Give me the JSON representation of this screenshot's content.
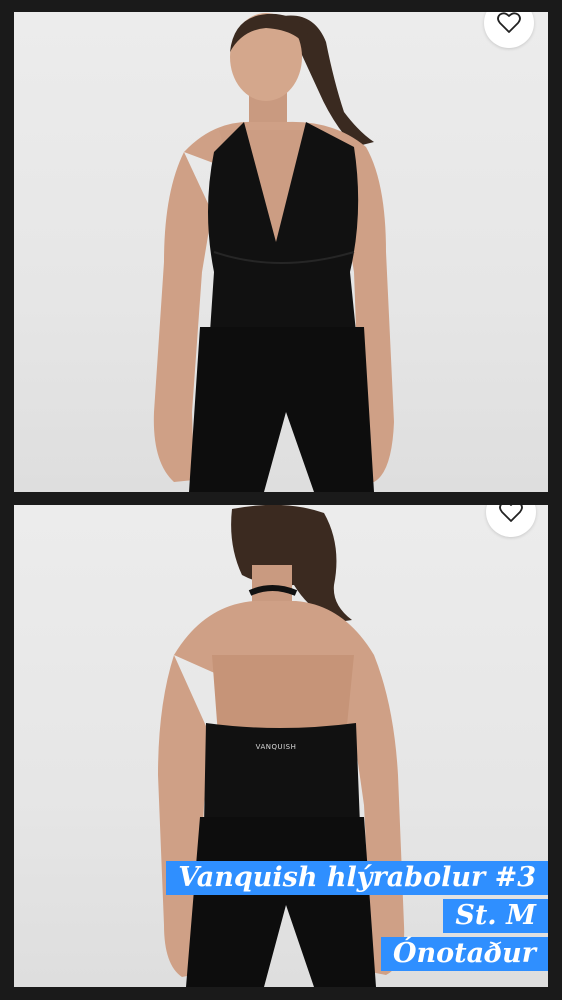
{
  "photos": [
    {
      "alt": "front"
    },
    {
      "alt": "back",
      "logo_text": "VANQUISH"
    }
  ],
  "favorite_icon": "heart-outline-icon",
  "caption": {
    "line1": "Vanquish hlýrabolur #3",
    "line2": "St. M",
    "line3": "Ónotaður"
  },
  "colors": {
    "caption_bg": "#2f8fff",
    "caption_text": "#ffffff",
    "background": "#e8e8e8"
  }
}
